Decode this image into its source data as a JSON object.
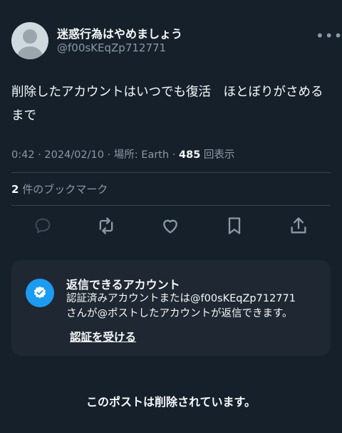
{
  "post": {
    "display_name": "迷惑行為はやめましょう",
    "handle": "@f00sKEqZp712771",
    "more_glyph": "•••",
    "text": "削除したアカウントはいつでも復活　ほとぼりがさめるまで",
    "time": "0:42",
    "date": "2024/02/10",
    "location": "場所: Earth",
    "view_count": "485",
    "view_label": "回表示",
    "bookmark_count": "2",
    "bookmark_label": "件のブックマーク"
  },
  "actions": [
    {
      "icon": "reply-icon",
      "color": "#8b98a5"
    },
    {
      "icon": "retweet-icon",
      "color": "#8b98a5"
    },
    {
      "icon": "heart-icon",
      "color": "#8b98a5"
    },
    {
      "icon": "bookmark-icon",
      "color": "#8b98a5"
    },
    {
      "icon": "share-icon",
      "color": "#8b98a5"
    }
  ],
  "reply_card": {
    "title": "返信できるアカウント",
    "body": "認証済みアカウントまたは@f00sKEqZp712771\nさんが@ポストしたアカウントが返信できます。",
    "link": "認証を受ける",
    "badge_color": "#1d9bf0"
  },
  "status": "このポストは削除されています。",
  "colors": {
    "background": "#15202b",
    "muted": "#8b98a5",
    "card": "#1e2732",
    "accent": "#1d9bf0"
  }
}
